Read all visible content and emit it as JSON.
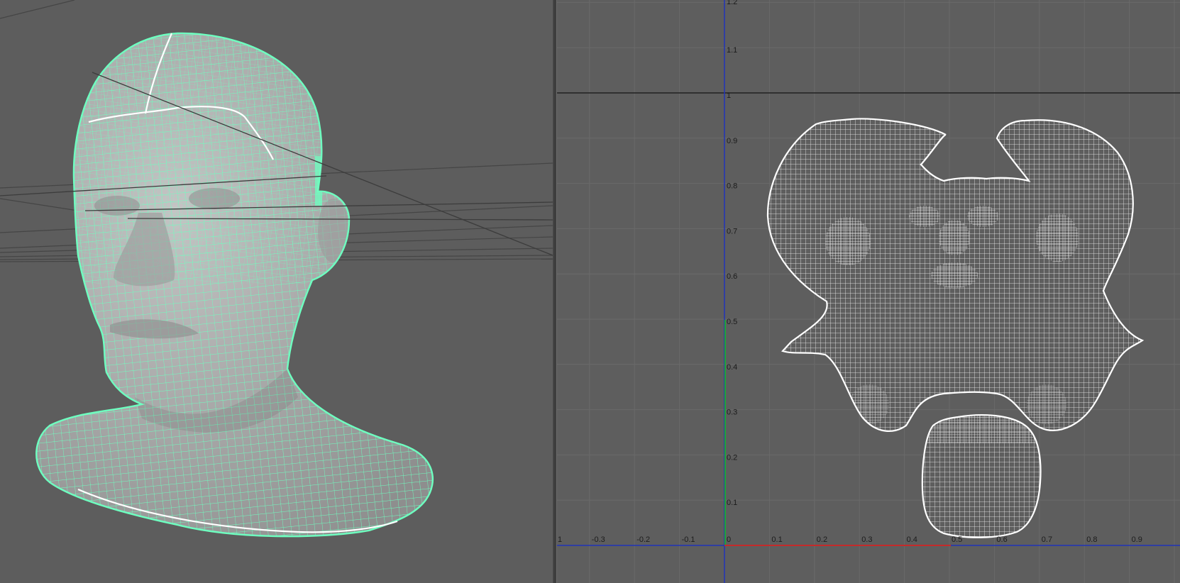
{
  "viewport3d": {
    "mesh": "head-bust",
    "wire_color": "#6effc0",
    "seam_color": "#ffffff",
    "background": "#5d5d5d"
  },
  "uv_editor": {
    "background": "#5e5e5e",
    "shell_color": "#ffffff",
    "grid_color": "#6a6a6a",
    "axis_u_color": "#c42a2a",
    "axis_v_color": "#1ea33a",
    "axis_lines_color": "#2034b8",
    "u_ticks": [
      "-0.3",
      "-0.2",
      "-0.1",
      "0",
      "0.1",
      "0.2",
      "0.3",
      "0.4",
      "0.5",
      "0.6",
      "0.7",
      "0.8",
      "0.9"
    ],
    "v_ticks": [
      "1.1",
      "1",
      "0.9",
      "0.8",
      "0.7",
      "0.6",
      "0.5",
      "0.4",
      "0.3",
      "0.2",
      "0.1"
    ],
    "left_tick_stub": "1",
    "top_tick_stub": "1.2"
  }
}
